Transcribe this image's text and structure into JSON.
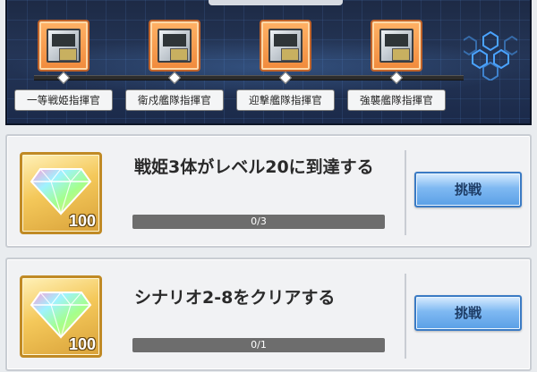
{
  "rank_track": {
    "ranks": [
      {
        "label": "一等戦姫指揮官"
      },
      {
        "label": "衛戍艦隊指揮官"
      },
      {
        "label": "迎撃艦隊指揮官"
      },
      {
        "label": "強襲艦隊指揮官"
      }
    ]
  },
  "missions": [
    {
      "title": "戦姫3体がレベル20に到達する",
      "reward_count": "100",
      "progress_text": "0/3",
      "progress_fraction": 0,
      "button_label": "挑戦"
    },
    {
      "title": "シナリオ2-8をクリアする",
      "reward_count": "100",
      "progress_text": "0/1",
      "progress_fraction": 0,
      "button_label": "挑戦"
    }
  ],
  "colors": {
    "panel_bg": "#1d2a45",
    "rank_icon_frame": "#f08a3c",
    "reward_frame": "#f4c85a",
    "button_blue": "#5a9fe6"
  },
  "icons": {
    "rank": "dock-cube-icon",
    "reward": "rainbow-crystal-icon",
    "decoration": "hexagon-cluster-icon"
  }
}
